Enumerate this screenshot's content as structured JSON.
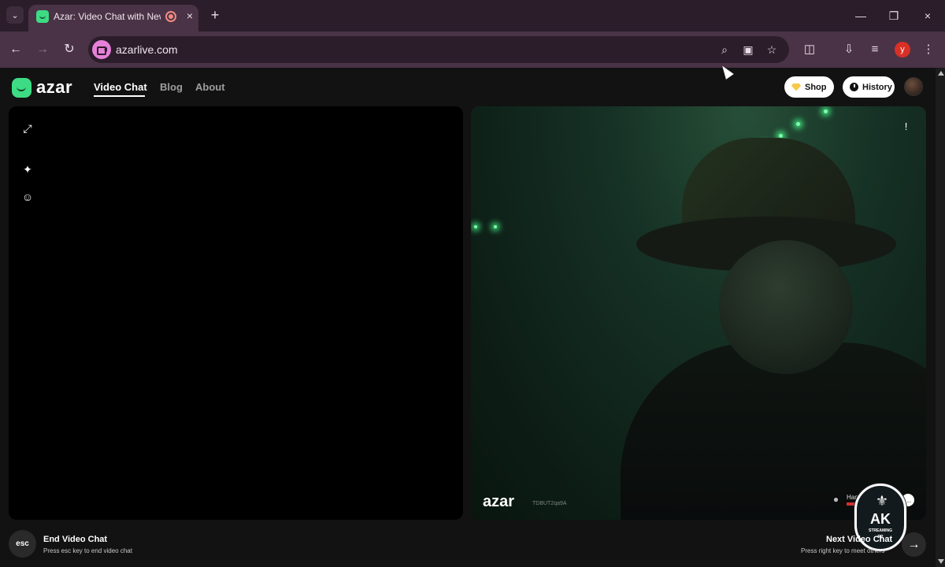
{
  "browser": {
    "tab_title": "Azar: Video Chat with New People",
    "url": "azarlive.com",
    "profile_initial": "y",
    "icons": {
      "tab_search": "chevron-down-icon",
      "record": "recording-icon",
      "close": "close-icon",
      "new_tab": "plus-icon",
      "back": "arrow-left-icon",
      "forward": "arrow-right-icon",
      "reload": "reload-icon",
      "zoom": "zoom-icon",
      "install": "install-icon",
      "bookmark": "star-icon",
      "extensions": "puzzle-icon",
      "download": "download-icon",
      "media": "media-control-icon",
      "menu": "kebab-menu-icon"
    },
    "colors": {
      "tab_strip": "#2b1d2a",
      "toolbar": "#4a3346",
      "omnibox": "#2b1d2a",
      "profile": "#d93025"
    }
  },
  "site": {
    "logo_text": "azar",
    "nav": [
      "Video Chat",
      "Blog",
      "About"
    ],
    "active_nav": "Video Chat",
    "shop_label": "Shop",
    "history_label": "History",
    "brand_color": "#3ddc84"
  },
  "video": {
    "left_tools": [
      "expand-icon",
      "sparkles-effect-icon",
      "face-filter-icon"
    ],
    "watermark_logo": "azar",
    "watermark_id": "TDBUT2qa9A",
    "partner_name": "Hani",
    "overlay_badge": {
      "title": "AK",
      "subtitle": "STREAMING",
      "suffix": "RP"
    }
  },
  "controls": {
    "esc_label": "esc",
    "end_title": "End Video Chat",
    "end_hint": "Press esc key to end video chat",
    "next_title": "Next Video Chat",
    "next_hint": "Press right key to meet others"
  }
}
